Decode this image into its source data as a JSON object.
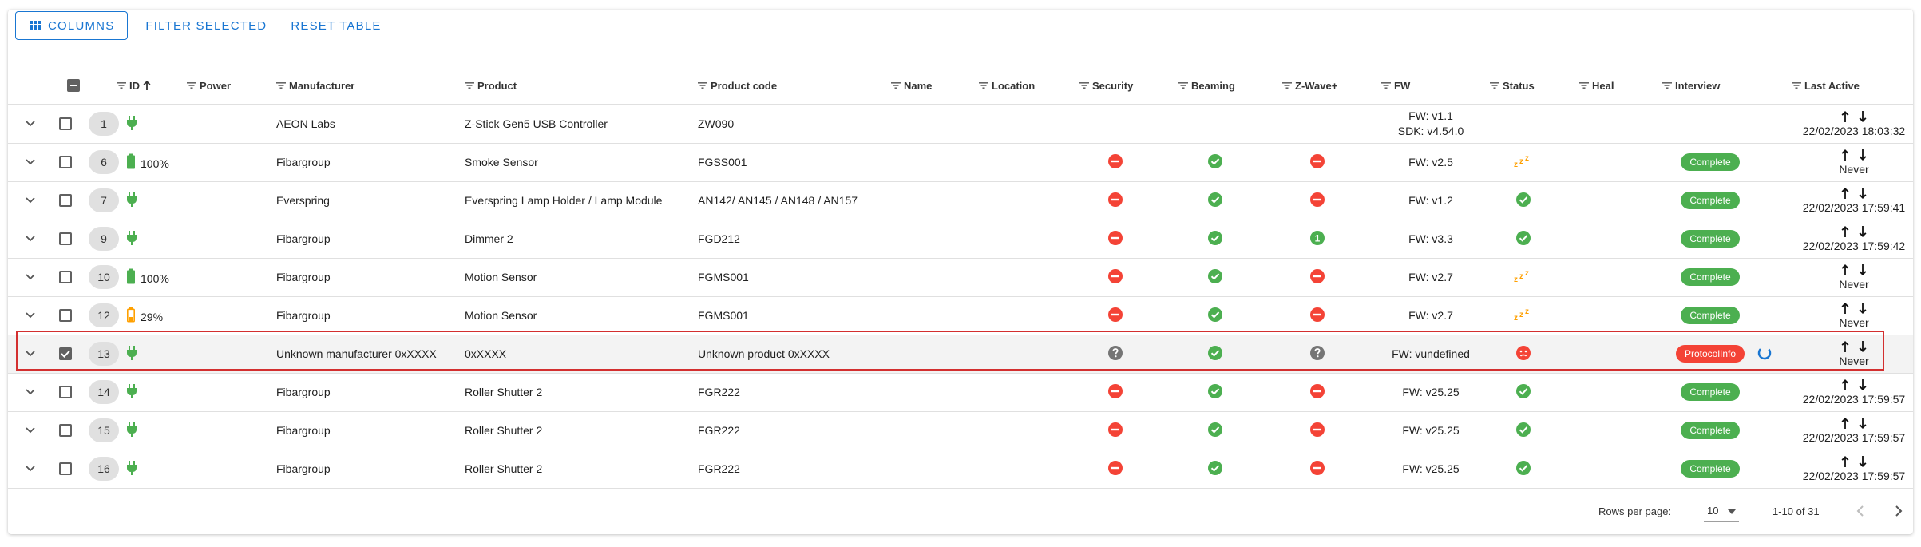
{
  "toolbar": {
    "columns_label": "Columns",
    "filter_selected_label": "Filter selected",
    "reset_table_label": "Reset table"
  },
  "columns": {
    "id": "ID",
    "power": "Power",
    "manufacturer": "Manufacturer",
    "product": "Product",
    "product_code": "Product code",
    "name": "Name",
    "location": "Location",
    "security": "Security",
    "beaming": "Beaming",
    "zwave_plus": "Z-Wave+",
    "fw": "FW",
    "status": "Status",
    "heal": "Heal",
    "interview": "Interview",
    "last_active": "Last Active"
  },
  "icons": {
    "columns": "view-column-icon",
    "filter": "filter-list-icon",
    "sort": "arrow-upward-icon",
    "expand": "chevron-down-icon",
    "plug": "power-plug-icon",
    "battery": "battery-icon",
    "security_no": "minus-circle-icon",
    "unknown": "help-circle-icon",
    "yes": "check-circle-icon",
    "zwave_level": "numbered-circle-icon",
    "asleep": "sleep-zzz-icon",
    "dead": "sad-face-icon",
    "spinner": "loading-spinner-icon"
  },
  "colors": {
    "accent": "#1976d2",
    "success": "#4caf50",
    "error": "#f44336",
    "unknown": "#9e9e9e",
    "sleep": "#ffa000",
    "battery_warn": "#ffa000",
    "highlight": "#d32f2f"
  },
  "rows": [
    {
      "id": "1",
      "power": "plug",
      "battery": "",
      "manufacturer": "AEON Labs",
      "product": "Z-Stick Gen5 USB Controller",
      "product_code": "ZW090",
      "name": "",
      "location": "",
      "security": "",
      "beaming": "",
      "zwave_plus": "",
      "zwave_value": "",
      "fw": "FW: v1.1",
      "fw2": "SDK: v4.54.0",
      "status": "",
      "interview": "",
      "last_active": "22/02/2023 18:03:32",
      "selected": false
    },
    {
      "id": "6",
      "power": "battery",
      "battery": "100%",
      "manufacturer": "Fibargroup",
      "product": "Smoke Sensor",
      "product_code": "FGSS001",
      "name": "",
      "location": "",
      "security": "no",
      "beaming": "yes",
      "zwave_plus": "no",
      "zwave_value": "",
      "fw": "FW: v2.5",
      "fw2": "",
      "status": "asleep",
      "interview": "Complete",
      "last_active": "Never",
      "selected": false
    },
    {
      "id": "7",
      "power": "plug",
      "battery": "",
      "manufacturer": "Everspring",
      "product": "Everspring Lamp Holder / Lamp Module",
      "product_code": "AN142/ AN145 / AN148 / AN157",
      "name": "",
      "location": "",
      "security": "no",
      "beaming": "yes",
      "zwave_plus": "no",
      "zwave_value": "",
      "fw": "FW: v1.2",
      "fw2": "",
      "status": "alive",
      "interview": "Complete",
      "last_active": "22/02/2023 17:59:41",
      "selected": false
    },
    {
      "id": "9",
      "power": "plug",
      "battery": "",
      "manufacturer": "Fibargroup",
      "product": "Dimmer 2",
      "product_code": "FGD212",
      "name": "",
      "location": "",
      "security": "no",
      "beaming": "yes",
      "zwave_plus": "level",
      "zwave_value": "1",
      "fw": "FW: v3.3",
      "fw2": "",
      "status": "alive",
      "interview": "Complete",
      "last_active": "22/02/2023 17:59:42",
      "selected": false
    },
    {
      "id": "10",
      "power": "battery",
      "battery": "100%",
      "manufacturer": "Fibargroup",
      "product": "Motion Sensor",
      "product_code": "FGMS001",
      "name": "",
      "location": "",
      "security": "no",
      "beaming": "yes",
      "zwave_plus": "no",
      "zwave_value": "",
      "fw": "FW: v2.7",
      "fw2": "",
      "status": "asleep",
      "interview": "Complete",
      "last_active": "Never",
      "selected": false
    },
    {
      "id": "12",
      "power": "battery-low",
      "battery": "29%",
      "manufacturer": "Fibargroup",
      "product": "Motion Sensor",
      "product_code": "FGMS001",
      "name": "",
      "location": "",
      "security": "no",
      "beaming": "yes",
      "zwave_plus": "no",
      "zwave_value": "",
      "fw": "FW: v2.7",
      "fw2": "",
      "status": "asleep",
      "interview": "Complete",
      "last_active": "Never",
      "selected": false
    },
    {
      "id": "13",
      "power": "plug",
      "battery": "",
      "manufacturer": "Unknown manufacturer 0xXXXX",
      "product": "0xXXXX",
      "product_code": "Unknown product 0xXXXX",
      "name": "",
      "location": "",
      "security": "unknown",
      "beaming": "yes",
      "zwave_plus": "unknown",
      "zwave_value": "",
      "fw": "FW: vundefined",
      "fw2": "",
      "status": "dead",
      "interview": "ProtocolInfo",
      "last_active": "Never",
      "selected": true
    },
    {
      "id": "14",
      "power": "plug",
      "battery": "",
      "manufacturer": "Fibargroup",
      "product": "Roller Shutter 2",
      "product_code": "FGR222",
      "name": "",
      "location": "",
      "security": "no",
      "beaming": "yes",
      "zwave_plus": "no",
      "zwave_value": "",
      "fw": "FW: v25.25",
      "fw2": "",
      "status": "alive",
      "interview": "Complete",
      "last_active": "22/02/2023 17:59:57",
      "selected": false
    },
    {
      "id": "15",
      "power": "plug",
      "battery": "",
      "manufacturer": "Fibargroup",
      "product": "Roller Shutter 2",
      "product_code": "FGR222",
      "name": "",
      "location": "",
      "security": "no",
      "beaming": "yes",
      "zwave_plus": "no",
      "zwave_value": "",
      "fw": "FW: v25.25",
      "fw2": "",
      "status": "alive",
      "interview": "Complete",
      "last_active": "22/02/2023 17:59:57",
      "selected": false
    },
    {
      "id": "16",
      "power": "plug",
      "battery": "",
      "manufacturer": "Fibargroup",
      "product": "Roller Shutter 2",
      "product_code": "FGR222",
      "name": "",
      "location": "",
      "security": "no",
      "beaming": "yes",
      "zwave_plus": "no",
      "zwave_value": "",
      "fw": "FW: v25.25",
      "fw2": "",
      "status": "alive",
      "interview": "Complete",
      "last_active": "22/02/2023 17:59:57",
      "selected": false
    }
  ],
  "pagination": {
    "rows_per_page_label": "Rows per page:",
    "rows_per_page_value": "10",
    "range_label": "1-10 of 31"
  }
}
